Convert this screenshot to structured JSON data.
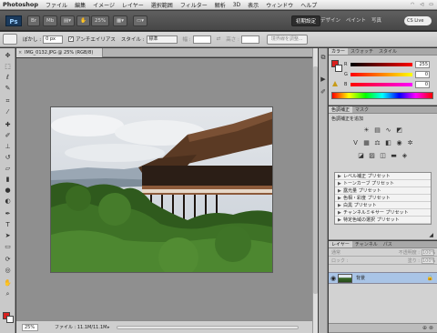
{
  "menubar": {
    "app": "Photoshop",
    "items": [
      "ファイル",
      "編集",
      "イメージ",
      "レイヤー",
      "選択範囲",
      "フィルター",
      "解析",
      "3D",
      "表示",
      "ウィンドウ",
      "ヘルプ"
    ]
  },
  "appbar": {
    "logo": "Ps",
    "zoom": "25%",
    "workspaces": [
      "初期設定",
      "デザイン",
      "ペイント",
      "写真"
    ],
    "search": "CS Live"
  },
  "options": {
    "feather_label": "ぼかし :",
    "feather_value": "0 px",
    "antialias": "アンチエイリアス",
    "style_label": "スタイル :",
    "style_value": "標準",
    "width_label": "幅 :",
    "height_label": "高さ :",
    "refine_edge": "境界線を調整..."
  },
  "document": {
    "tab_title": "IMG_0132.JPG @ 25% (RGB/8)",
    "zoom": "25%",
    "file_info": "ファイル : 11.1M/11.1M"
  },
  "color_panel": {
    "tabs": [
      "カラー",
      "スウォッチ",
      "スタイル"
    ],
    "rows": [
      {
        "label": "R",
        "value": "255",
        "color": "#ff0000"
      },
      {
        "label": "G",
        "value": "0",
        "color": "#00ff00"
      },
      {
        "label": "B",
        "value": "0",
        "color": "#0000ff"
      }
    ],
    "foreground": "#d9201e"
  },
  "adjustments_panel": {
    "tabs": [
      "色調補正",
      "マスク"
    ],
    "title": "色調補正を追加",
    "presets": [
      "レベル補正 プリセット",
      "トーンカーブ プリセット",
      "露光量 プリセット",
      "色相・彩度 プリセット",
      "白黒 プリセット",
      "チャンネルミキサー プリセット",
      "特定色域の選択 プリセット"
    ]
  },
  "layers_panel": {
    "tabs": [
      "レイヤー",
      "チャンネル",
      "パス"
    ],
    "blend_mode": "通常",
    "opacity_label": "不透明度 :",
    "opacity": "100%",
    "lock_label": "ロック :",
    "fill_label": "塗り :",
    "fill": "100%",
    "layer_name": "背景"
  }
}
